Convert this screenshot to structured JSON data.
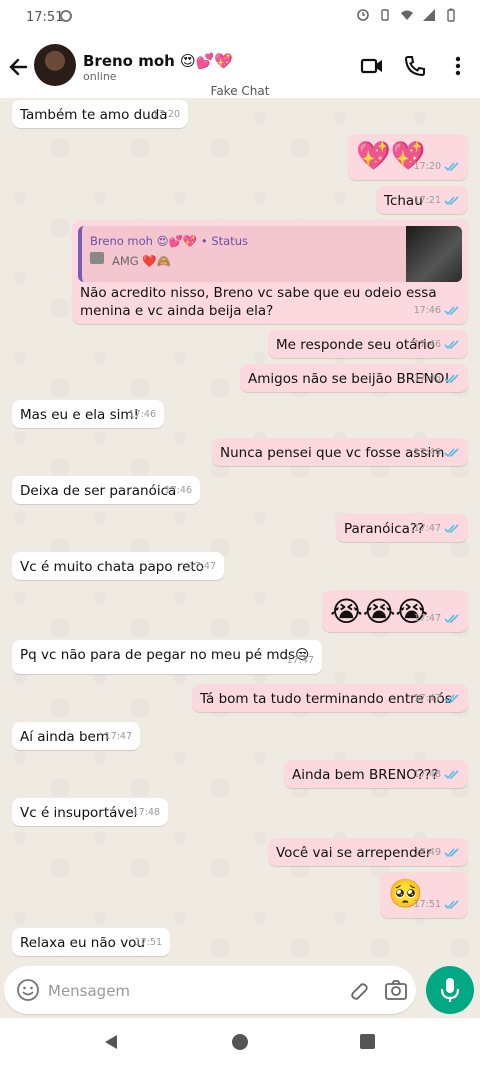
{
  "status_bar": {
    "time": "17:51"
  },
  "header": {
    "contact_name": "Breno moh 😍💕💖",
    "contact_status": "online",
    "watermark": "Fake Chat"
  },
  "messages": [
    {
      "dir": "in",
      "text": "Também te amo duda",
      "time": "17:20"
    },
    {
      "dir": "out",
      "text": "💖💖",
      "time": "17:20",
      "ticks": true
    },
    {
      "dir": "out",
      "text": "Tchau",
      "time": "17:21",
      "ticks": true
    },
    {
      "dir": "out",
      "quote_name": "Breno moh 😍💕💖 • Status",
      "quote_text": "AMG ❤️🙈",
      "text": "Não acredito nisso, Breno vc sabe que eu odeio essa menina e vc ainda beija ela?",
      "time": "17:46",
      "ticks": true
    },
    {
      "dir": "out",
      "text": "Me responde seu otário",
      "time": "17:46",
      "ticks": true
    },
    {
      "dir": "out",
      "text": "Amigos não se beijão BRENO!",
      "time": "17:46",
      "ticks": true
    },
    {
      "dir": "in",
      "text": "Mas eu e ela sim!",
      "time": "17:46"
    },
    {
      "dir": "out",
      "text": "Nunca pensei que vc fosse assim",
      "time": "17:46",
      "ticks": true
    },
    {
      "dir": "in",
      "text": "Deixa de ser paranóica",
      "time": "17:46"
    },
    {
      "dir": "out",
      "text": "Paranóica??",
      "time": "17:47",
      "ticks": true
    },
    {
      "dir": "in",
      "text": "Vc é muito chata papo reto",
      "time": "17:47"
    },
    {
      "dir": "out",
      "text": "😭😭😭",
      "time": "17:47",
      "ticks": true
    },
    {
      "dir": "in",
      "text": "Pq vc não para de pegar no meu pé mds😒",
      "time": "17:47"
    },
    {
      "dir": "out",
      "text": "Tá bom ta tudo terminando entre nós",
      "time": "17:47",
      "ticks": true
    },
    {
      "dir": "in",
      "text": "Aí ainda bem",
      "time": "17:47"
    },
    {
      "dir": "out",
      "text": "Ainda bem BRENO???",
      "time": "17:48",
      "ticks": true
    },
    {
      "dir": "in",
      "text": "Vc é insuportável",
      "time": "17:48"
    },
    {
      "dir": "out",
      "text": "Você vai se arrepender",
      "time": "17:49",
      "ticks": true
    },
    {
      "dir": "out",
      "text": "🥺",
      "time": "17:51",
      "ticks": true
    },
    {
      "dir": "in",
      "text": "Relaxa eu não vou",
      "time": "17:51"
    }
  ],
  "input": {
    "placeholder": "Mensagem"
  },
  "colors": {
    "outgoing": "#fbd9df",
    "incoming": "#ffffff",
    "tick": "#53bdeb",
    "mic": "#00a884"
  },
  "icons": [
    "back-arrow-icon",
    "video-call-icon",
    "phone-icon",
    "more-vert-icon",
    "emoji-icon",
    "attach-icon",
    "camera-icon",
    "mic-icon"
  ]
}
